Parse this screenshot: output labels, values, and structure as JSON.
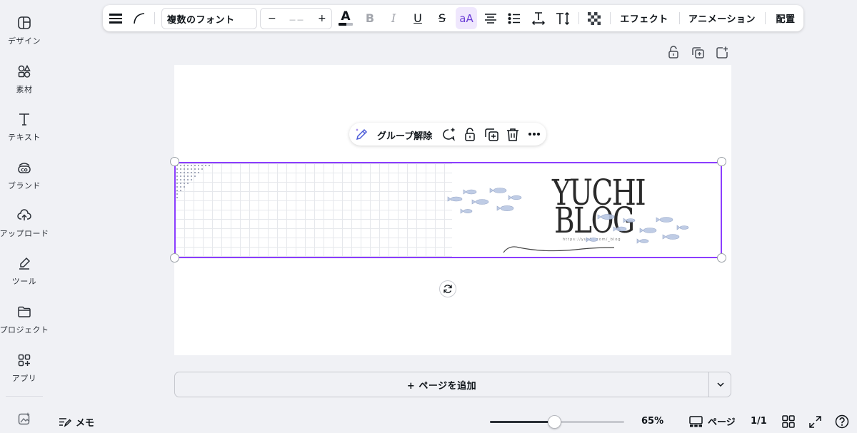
{
  "sidebar": {
    "items": [
      {
        "label": "デザイン",
        "icon": "design-icon"
      },
      {
        "label": "素材",
        "icon": "elements-icon"
      },
      {
        "label": "テキスト",
        "icon": "text-icon"
      },
      {
        "label": "ブランド",
        "icon": "brand-icon"
      },
      {
        "label": "アップロード",
        "icon": "upload-icon"
      },
      {
        "label": "ツール",
        "icon": "tools-icon"
      },
      {
        "label": "プロジェクト",
        "icon": "projects-icon"
      },
      {
        "label": "アプリ",
        "icon": "apps-icon"
      }
    ],
    "bottom_icon": "magic-media-icon"
  },
  "toolbar": {
    "font": "複数のフォント",
    "size_minus": "−",
    "size_value": "－－",
    "size_plus": "+",
    "text_color_glyph": "A",
    "bold": "B",
    "italic": "I",
    "underline": "U",
    "strike": "S",
    "case": "aA",
    "effects": "エフェクト",
    "animation": "アニメーション",
    "position": "配置"
  },
  "context_menu": {
    "ungroup": "グループ解除"
  },
  "banner": {
    "line1": "YUCHI",
    "line2": "BLOG",
    "url": "https://yuchi.com/_blog"
  },
  "add_page": {
    "label": "+ ページを追加"
  },
  "footer": {
    "memo": "メモ",
    "zoom_percent": 65,
    "zoom_label": "65%",
    "pages": "ページ",
    "page_count": "1/1"
  },
  "colors": {
    "accent": "#8b3dff",
    "background": "#f0f1f5"
  }
}
